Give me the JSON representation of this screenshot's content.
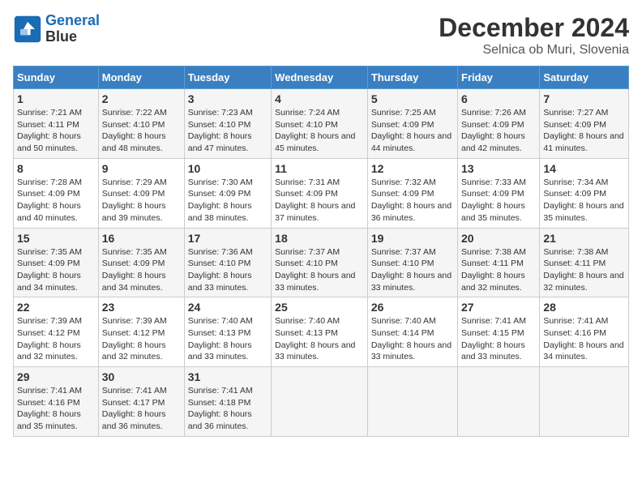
{
  "header": {
    "logo_line1": "General",
    "logo_line2": "Blue",
    "title": "December 2024",
    "subtitle": "Selnica ob Muri, Slovenia"
  },
  "weekdays": [
    "Sunday",
    "Monday",
    "Tuesday",
    "Wednesday",
    "Thursday",
    "Friday",
    "Saturday"
  ],
  "weeks": [
    [
      {
        "day": "1",
        "sunrise": "Sunrise: 7:21 AM",
        "sunset": "Sunset: 4:11 PM",
        "daylight": "Daylight: 8 hours and 50 minutes."
      },
      {
        "day": "2",
        "sunrise": "Sunrise: 7:22 AM",
        "sunset": "Sunset: 4:10 PM",
        "daylight": "Daylight: 8 hours and 48 minutes."
      },
      {
        "day": "3",
        "sunrise": "Sunrise: 7:23 AM",
        "sunset": "Sunset: 4:10 PM",
        "daylight": "Daylight: 8 hours and 47 minutes."
      },
      {
        "day": "4",
        "sunrise": "Sunrise: 7:24 AM",
        "sunset": "Sunset: 4:10 PM",
        "daylight": "Daylight: 8 hours and 45 minutes."
      },
      {
        "day": "5",
        "sunrise": "Sunrise: 7:25 AM",
        "sunset": "Sunset: 4:09 PM",
        "daylight": "Daylight: 8 hours and 44 minutes."
      },
      {
        "day": "6",
        "sunrise": "Sunrise: 7:26 AM",
        "sunset": "Sunset: 4:09 PM",
        "daylight": "Daylight: 8 hours and 42 minutes."
      },
      {
        "day": "7",
        "sunrise": "Sunrise: 7:27 AM",
        "sunset": "Sunset: 4:09 PM",
        "daylight": "Daylight: 8 hours and 41 minutes."
      }
    ],
    [
      {
        "day": "8",
        "sunrise": "Sunrise: 7:28 AM",
        "sunset": "Sunset: 4:09 PM",
        "daylight": "Daylight: 8 hours and 40 minutes."
      },
      {
        "day": "9",
        "sunrise": "Sunrise: 7:29 AM",
        "sunset": "Sunset: 4:09 PM",
        "daylight": "Daylight: 8 hours and 39 minutes."
      },
      {
        "day": "10",
        "sunrise": "Sunrise: 7:30 AM",
        "sunset": "Sunset: 4:09 PM",
        "daylight": "Daylight: 8 hours and 38 minutes."
      },
      {
        "day": "11",
        "sunrise": "Sunrise: 7:31 AM",
        "sunset": "Sunset: 4:09 PM",
        "daylight": "Daylight: 8 hours and 37 minutes."
      },
      {
        "day": "12",
        "sunrise": "Sunrise: 7:32 AM",
        "sunset": "Sunset: 4:09 PM",
        "daylight": "Daylight: 8 hours and 36 minutes."
      },
      {
        "day": "13",
        "sunrise": "Sunrise: 7:33 AM",
        "sunset": "Sunset: 4:09 PM",
        "daylight": "Daylight: 8 hours and 35 minutes."
      },
      {
        "day": "14",
        "sunrise": "Sunrise: 7:34 AM",
        "sunset": "Sunset: 4:09 PM",
        "daylight": "Daylight: 8 hours and 35 minutes."
      }
    ],
    [
      {
        "day": "15",
        "sunrise": "Sunrise: 7:35 AM",
        "sunset": "Sunset: 4:09 PM",
        "daylight": "Daylight: 8 hours and 34 minutes."
      },
      {
        "day": "16",
        "sunrise": "Sunrise: 7:35 AM",
        "sunset": "Sunset: 4:09 PM",
        "daylight": "Daylight: 8 hours and 34 minutes."
      },
      {
        "day": "17",
        "sunrise": "Sunrise: 7:36 AM",
        "sunset": "Sunset: 4:10 PM",
        "daylight": "Daylight: 8 hours and 33 minutes."
      },
      {
        "day": "18",
        "sunrise": "Sunrise: 7:37 AM",
        "sunset": "Sunset: 4:10 PM",
        "daylight": "Daylight: 8 hours and 33 minutes."
      },
      {
        "day": "19",
        "sunrise": "Sunrise: 7:37 AM",
        "sunset": "Sunset: 4:10 PM",
        "daylight": "Daylight: 8 hours and 33 minutes."
      },
      {
        "day": "20",
        "sunrise": "Sunrise: 7:38 AM",
        "sunset": "Sunset: 4:11 PM",
        "daylight": "Daylight: 8 hours and 32 minutes."
      },
      {
        "day": "21",
        "sunrise": "Sunrise: 7:38 AM",
        "sunset": "Sunset: 4:11 PM",
        "daylight": "Daylight: 8 hours and 32 minutes."
      }
    ],
    [
      {
        "day": "22",
        "sunrise": "Sunrise: 7:39 AM",
        "sunset": "Sunset: 4:12 PM",
        "daylight": "Daylight: 8 hours and 32 minutes."
      },
      {
        "day": "23",
        "sunrise": "Sunrise: 7:39 AM",
        "sunset": "Sunset: 4:12 PM",
        "daylight": "Daylight: 8 hours and 32 minutes."
      },
      {
        "day": "24",
        "sunrise": "Sunrise: 7:40 AM",
        "sunset": "Sunset: 4:13 PM",
        "daylight": "Daylight: 8 hours and 33 minutes."
      },
      {
        "day": "25",
        "sunrise": "Sunrise: 7:40 AM",
        "sunset": "Sunset: 4:13 PM",
        "daylight": "Daylight: 8 hours and 33 minutes."
      },
      {
        "day": "26",
        "sunrise": "Sunrise: 7:40 AM",
        "sunset": "Sunset: 4:14 PM",
        "daylight": "Daylight: 8 hours and 33 minutes."
      },
      {
        "day": "27",
        "sunrise": "Sunrise: 7:41 AM",
        "sunset": "Sunset: 4:15 PM",
        "daylight": "Daylight: 8 hours and 33 minutes."
      },
      {
        "day": "28",
        "sunrise": "Sunrise: 7:41 AM",
        "sunset": "Sunset: 4:16 PM",
        "daylight": "Daylight: 8 hours and 34 minutes."
      }
    ],
    [
      {
        "day": "29",
        "sunrise": "Sunrise: 7:41 AM",
        "sunset": "Sunset: 4:16 PM",
        "daylight": "Daylight: 8 hours and 35 minutes."
      },
      {
        "day": "30",
        "sunrise": "Sunrise: 7:41 AM",
        "sunset": "Sunset: 4:17 PM",
        "daylight": "Daylight: 8 hours and 36 minutes."
      },
      {
        "day": "31",
        "sunrise": "Sunrise: 7:41 AM",
        "sunset": "Sunset: 4:18 PM",
        "daylight": "Daylight: 8 hours and 36 minutes."
      },
      null,
      null,
      null,
      null
    ]
  ]
}
